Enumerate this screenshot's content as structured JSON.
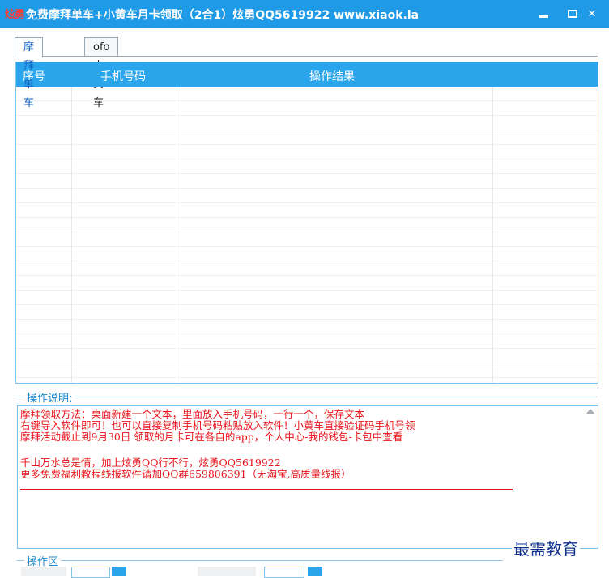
{
  "window": {
    "icon_text": "炫勇",
    "title": "免费摩拜单车+小黄车月卡领取（2合1）炫勇QQ5619922  www.xiaok.la",
    "minimize_icon": "minimize-icon",
    "maximize_icon": "maximize-icon",
    "close_icon": "close-icon",
    "close_label": "✕"
  },
  "tabs": [
    {
      "label": "摩拜单车",
      "active": true
    },
    {
      "label": "ofo小黄车",
      "active": false
    }
  ],
  "grid": {
    "columns": [
      "序号",
      "手机号码",
      "操作结果"
    ],
    "rows": []
  },
  "instructions": {
    "title": "操作说明:",
    "lines": [
      "摩拜领取方法：桌面新建一个文本，里面放入手机号码，一行一个，保存文本",
      "右键导入软件即可！也可以直接复制手机号码粘贴放入软件！小黄车直接验证码手机号领",
      "摩拜活动截止到9月30日 领取的月卡可在各自的app，个人中心-我的钱包-卡包中查看",
      "",
      "千山万水总是情，加上炫勇QQ行不行，炫勇QQ5619922",
      "更多免费福利教程线报软件请加QQ群659806391（无淘宝,高质量线报）"
    ]
  },
  "operation_area": {
    "title": "操作区"
  },
  "watermark": "最需教育",
  "colors": {
    "titlebar": "#1e9ae6",
    "header": "#2aa5ec",
    "note_text": "#e8141b",
    "accent": "#1366c4"
  }
}
